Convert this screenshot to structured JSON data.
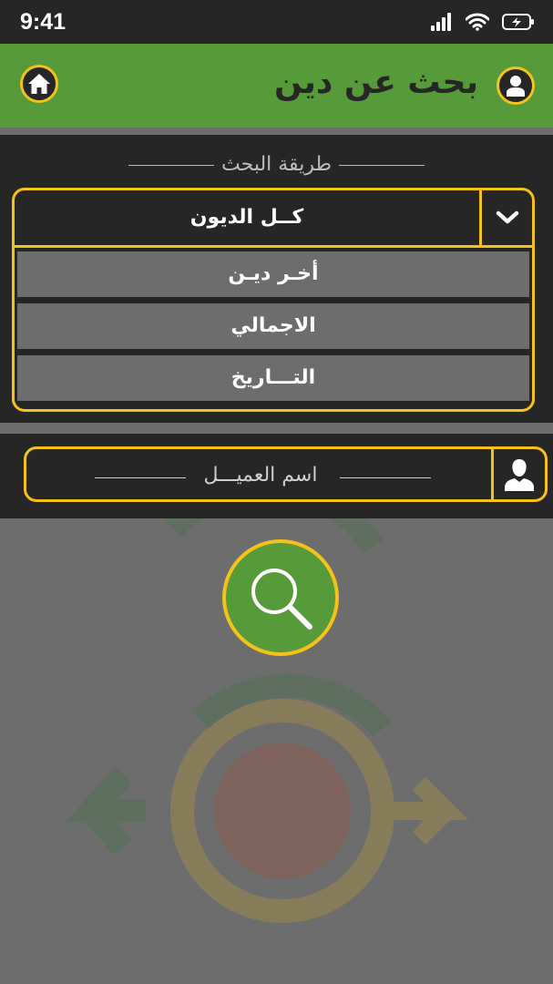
{
  "status_bar": {
    "time": "9:41"
  },
  "header": {
    "title": "بحث عن دين"
  },
  "search_method": {
    "label": "طريقة البحث",
    "selected": "كــل الديون",
    "options": [
      "أخـر ديـن",
      "الاجمالي",
      "التـــاريخ"
    ]
  },
  "customer": {
    "placeholder": "اسم العميـــل"
  },
  "icons": {
    "home": "home-icon",
    "user": "user-icon",
    "chevron": "chevron-down-icon",
    "search": "search-icon",
    "person": "person-icon"
  },
  "colors": {
    "header_green": "#569a3a",
    "accent_yellow": "#f4c21b",
    "panel_dark": "#262626",
    "background_gray": "#6d6d6d"
  }
}
